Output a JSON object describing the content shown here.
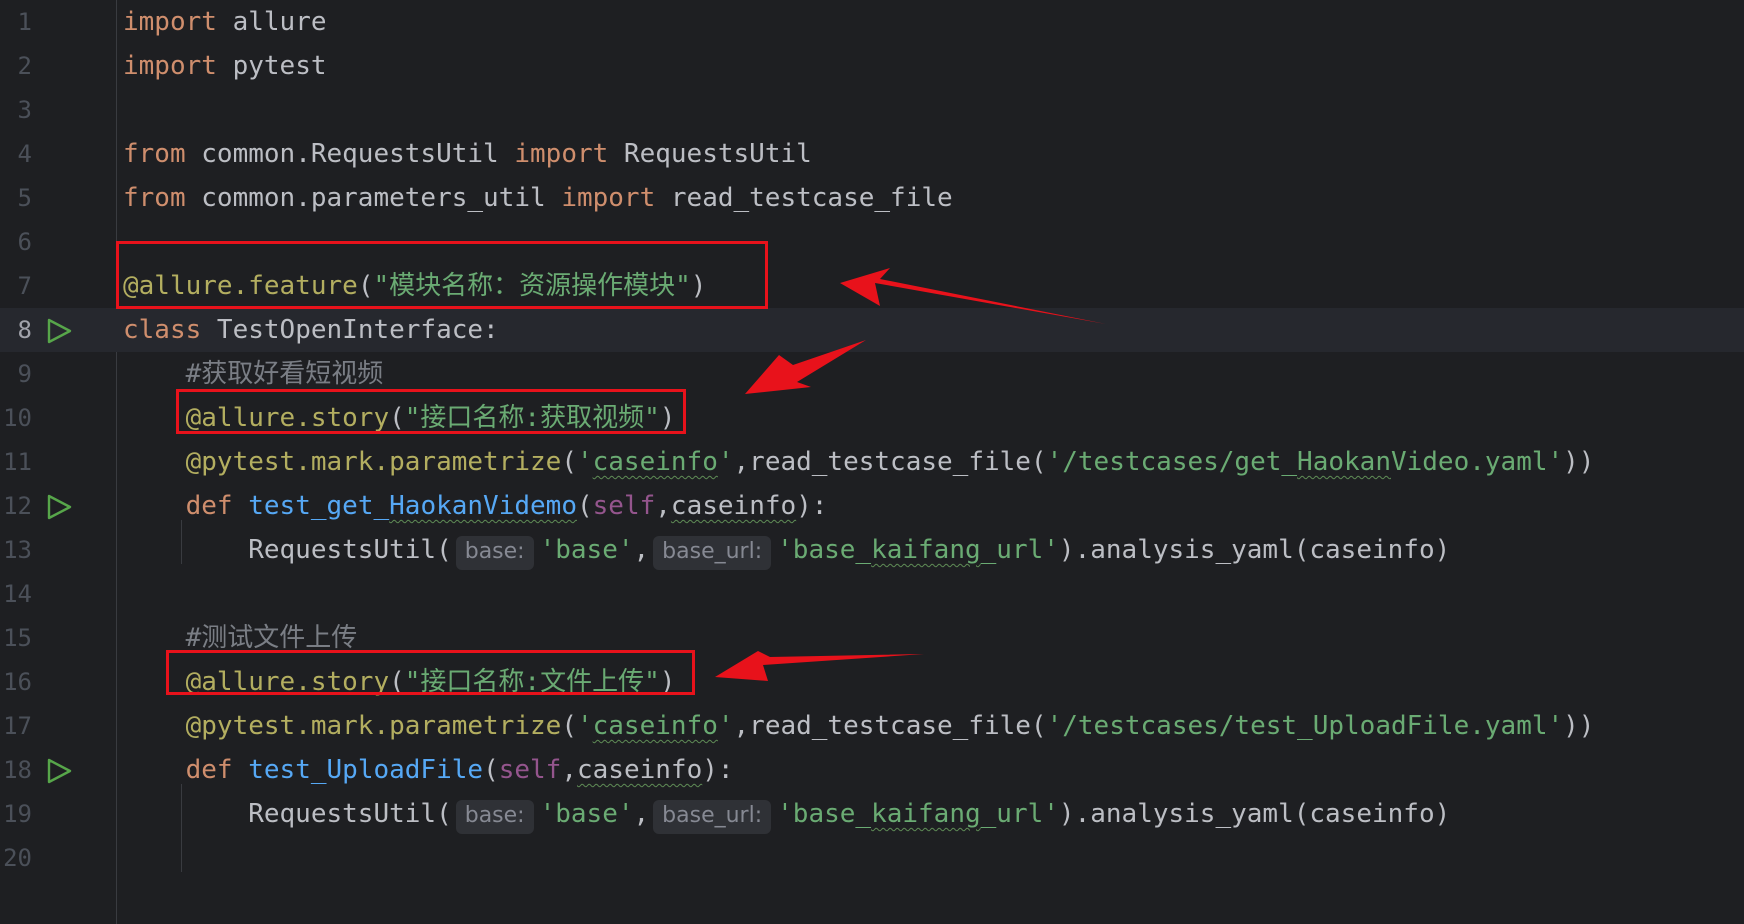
{
  "editor": {
    "current_line": 8,
    "lines": [
      {
        "num": "1",
        "tokens": [
          {
            "t": "import",
            "c": "kw"
          },
          {
            "t": " allure"
          }
        ]
      },
      {
        "num": "2",
        "tokens": [
          {
            "t": "import",
            "c": "kw"
          },
          {
            "t": " pytest"
          }
        ]
      },
      {
        "num": "3",
        "tokens": []
      },
      {
        "num": "4",
        "tokens": [
          {
            "t": "from",
            "c": "kw"
          },
          {
            "t": " common.RequestsUtil "
          },
          {
            "t": "import",
            "c": "kw"
          },
          {
            "t": " RequestsUtil"
          }
        ]
      },
      {
        "num": "5",
        "tokens": [
          {
            "t": "from",
            "c": "kw"
          },
          {
            "t": " common.parameters_util "
          },
          {
            "t": "import",
            "c": "kw"
          },
          {
            "t": " read_testcase_file"
          }
        ]
      },
      {
        "num": "6",
        "tokens": []
      },
      {
        "num": "7",
        "tokens": [
          {
            "t": "@allure.feature",
            "c": "deco"
          },
          {
            "t": "("
          },
          {
            "t": "\"模块名称：资源操作模块\"",
            "c": "str"
          },
          {
            "t": ")"
          }
        ]
      },
      {
        "num": "8",
        "run": true,
        "tokens": [
          {
            "t": "class",
            "c": "kw"
          },
          {
            "t": " TestOpenInterface:"
          }
        ]
      },
      {
        "num": "9",
        "tokens": [
          {
            "t": "    "
          },
          {
            "t": "#获取好看短视频",
            "c": "cmt"
          }
        ]
      },
      {
        "num": "10",
        "tokens": [
          {
            "t": "    "
          },
          {
            "t": "@allure.story",
            "c": "deco"
          },
          {
            "t": "("
          },
          {
            "t": "\"接口名称:获取视频\"",
            "c": "str"
          },
          {
            "t": ")"
          }
        ]
      },
      {
        "num": "11",
        "tokens": [
          {
            "t": "    "
          },
          {
            "t": "@pytest.mark.parametrize",
            "c": "deco"
          },
          {
            "t": "("
          },
          {
            "t": "'",
            "c": "str"
          },
          {
            "t": "caseinfo",
            "c": "str sq"
          },
          {
            "t": "'",
            "c": "str"
          },
          {
            "t": ",read_testcase_file("
          },
          {
            "t": "'/testcases/get_",
            "c": "str"
          },
          {
            "t": "Haokan",
            "c": "str sq"
          },
          {
            "t": "Video.yaml'",
            "c": "str"
          },
          {
            "t": "))"
          }
        ]
      },
      {
        "num": "12",
        "run": true,
        "tokens": [
          {
            "t": "    "
          },
          {
            "t": "def",
            "c": "kw"
          },
          {
            "t": " "
          },
          {
            "t": "test_get_",
            "c": "fn"
          },
          {
            "t": "HaokanVidemo",
            "c": "fn sq"
          },
          {
            "t": "("
          },
          {
            "t": "self",
            "c": "self"
          },
          {
            "t": ","
          },
          {
            "t": "caseinfo",
            "c": "sq"
          },
          {
            "t": "):"
          }
        ]
      },
      {
        "num": "13",
        "tokens": [
          {
            "t": "        RequestsUtil("
          },
          {
            "hint": "base:"
          },
          {
            "t": "'base'",
            "c": "str"
          },
          {
            "t": ","
          },
          {
            "hint": "base_url:"
          },
          {
            "t": "'base_",
            "c": "str"
          },
          {
            "t": "kaifang",
            "c": "str sq"
          },
          {
            "t": "_url'",
            "c": "str"
          },
          {
            "t": ").analysis_yaml(caseinfo)"
          }
        ]
      },
      {
        "num": "14",
        "tokens": []
      },
      {
        "num": "15",
        "tokens": [
          {
            "t": "    "
          },
          {
            "t": "#测试文件上传",
            "c": "cmt"
          }
        ]
      },
      {
        "num": "16",
        "tokens": [
          {
            "t": "    "
          },
          {
            "t": "@allure.story",
            "c": "deco"
          },
          {
            "t": "("
          },
          {
            "t": "\"接口名称:文件上传\"",
            "c": "str"
          },
          {
            "t": ")"
          }
        ]
      },
      {
        "num": "17",
        "tokens": [
          {
            "t": "    "
          },
          {
            "t": "@pytest.mark.parametrize",
            "c": "deco"
          },
          {
            "t": "("
          },
          {
            "t": "'",
            "c": "str"
          },
          {
            "t": "caseinfo",
            "c": "str sq"
          },
          {
            "t": "'",
            "c": "str"
          },
          {
            "t": ",read_testcase_file("
          },
          {
            "t": "'/testcases/test_UploadFile.yaml'",
            "c": "str"
          },
          {
            "t": "))"
          }
        ]
      },
      {
        "num": "18",
        "run": true,
        "tokens": [
          {
            "t": "    "
          },
          {
            "t": "def",
            "c": "kw"
          },
          {
            "t": " "
          },
          {
            "t": "test_UploadFile",
            "c": "fn"
          },
          {
            "t": "("
          },
          {
            "t": "self",
            "c": "self"
          },
          {
            "t": ","
          },
          {
            "t": "caseinfo",
            "c": "sq"
          },
          {
            "t": "):"
          }
        ]
      },
      {
        "num": "19",
        "tokens": [
          {
            "t": "        RequestsUtil("
          },
          {
            "hint": "base:"
          },
          {
            "t": "'base'",
            "c": "str"
          },
          {
            "t": ","
          },
          {
            "hint": "base_url:"
          },
          {
            "t": "'base_",
            "c": "str"
          },
          {
            "t": "kaifang",
            "c": "str sq"
          },
          {
            "t": "_url'",
            "c": "str"
          },
          {
            "t": ").analysis_yaml(caseinfo)"
          }
        ]
      },
      {
        "num": "20",
        "tokens": []
      }
    ]
  },
  "colors": {
    "background": "#1e1f22",
    "keyword": "#cf8e6d",
    "decorator": "#b3ae60",
    "string": "#6aab73",
    "comment": "#7a7e85",
    "function": "#56a8f5",
    "annotation": "#e8121b"
  },
  "icons": {
    "gutter_run": "run-triangle-icon",
    "annotation_arrow": "red-arrow-icon"
  }
}
